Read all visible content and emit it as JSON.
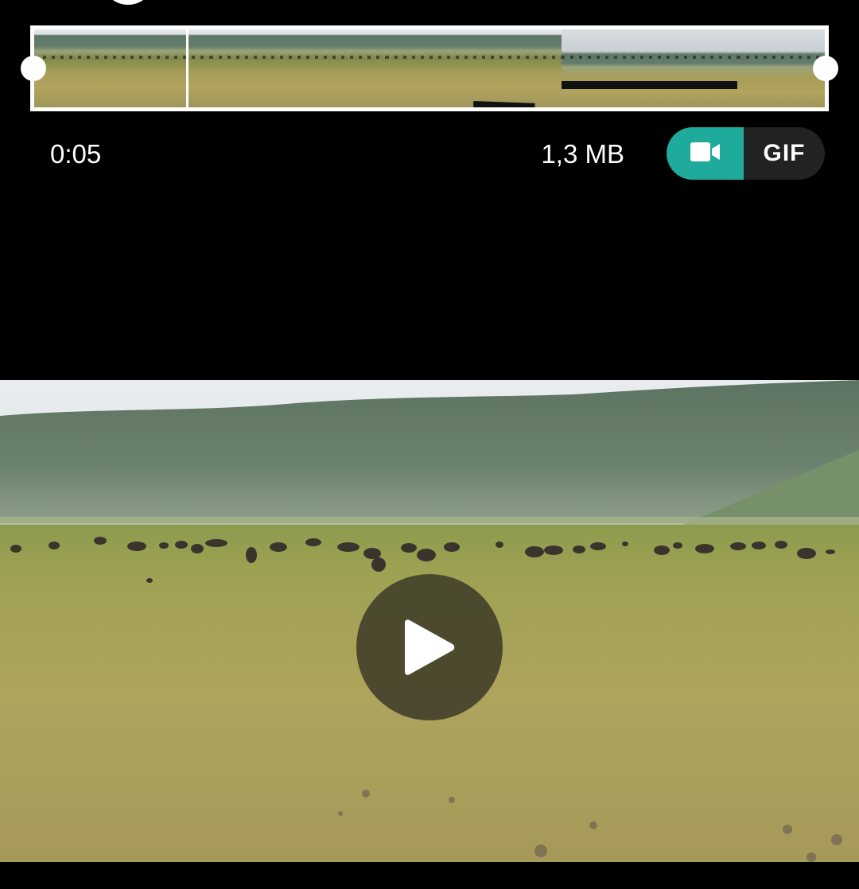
{
  "trimmer": {
    "frame_count": 9
  },
  "info": {
    "duration": "0:05",
    "file_size": "1,3 MB"
  },
  "mode_toggle": {
    "video_icon": "video-camera-icon",
    "gif_label": "GIF",
    "selected": "video",
    "selected_color": "#1fab9b"
  },
  "preview": {
    "play_icon": "play-icon"
  }
}
